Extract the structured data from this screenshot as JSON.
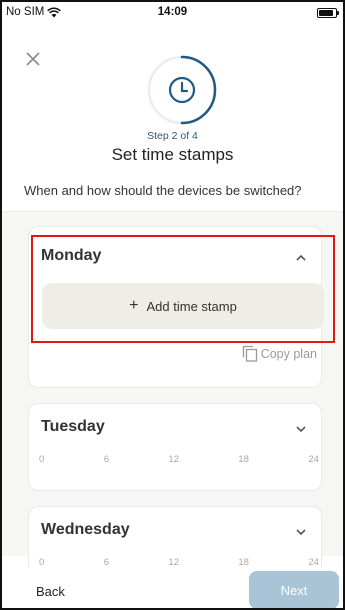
{
  "status_bar": {
    "carrier": "No SIM",
    "time": "14:09",
    "battery_level": 0.9
  },
  "header": {
    "close_icon": "close-icon",
    "progress_icon": "clock-icon",
    "progress_fraction": 0.5,
    "step_text": "Step 2 of 4",
    "title": "Set time stamps",
    "subtitle": "When and how should the devices be switched?"
  },
  "days": [
    {
      "name": "Monday",
      "expanded": true,
      "chevron_icon": "chevron-up-icon",
      "add_label": "Add time stamp",
      "copy_label": "Copy plan"
    },
    {
      "name": "Tuesday",
      "expanded": false,
      "chevron_icon": "chevron-down-icon",
      "ticks": [
        "0",
        "6",
        "12",
        "18",
        "24"
      ]
    },
    {
      "name": "Wednesday",
      "expanded": false,
      "chevron_icon": "chevron-down-icon",
      "ticks": [
        "0",
        "6",
        "12",
        "18",
        "24"
      ]
    }
  ],
  "footer": {
    "back_label": "Back",
    "next_label": "Next"
  },
  "colors": {
    "accent": "#1e5a85",
    "next_disabled": "#a9c4d6",
    "highlight": "#e01818",
    "add_button_bg": "#eeeee6"
  }
}
